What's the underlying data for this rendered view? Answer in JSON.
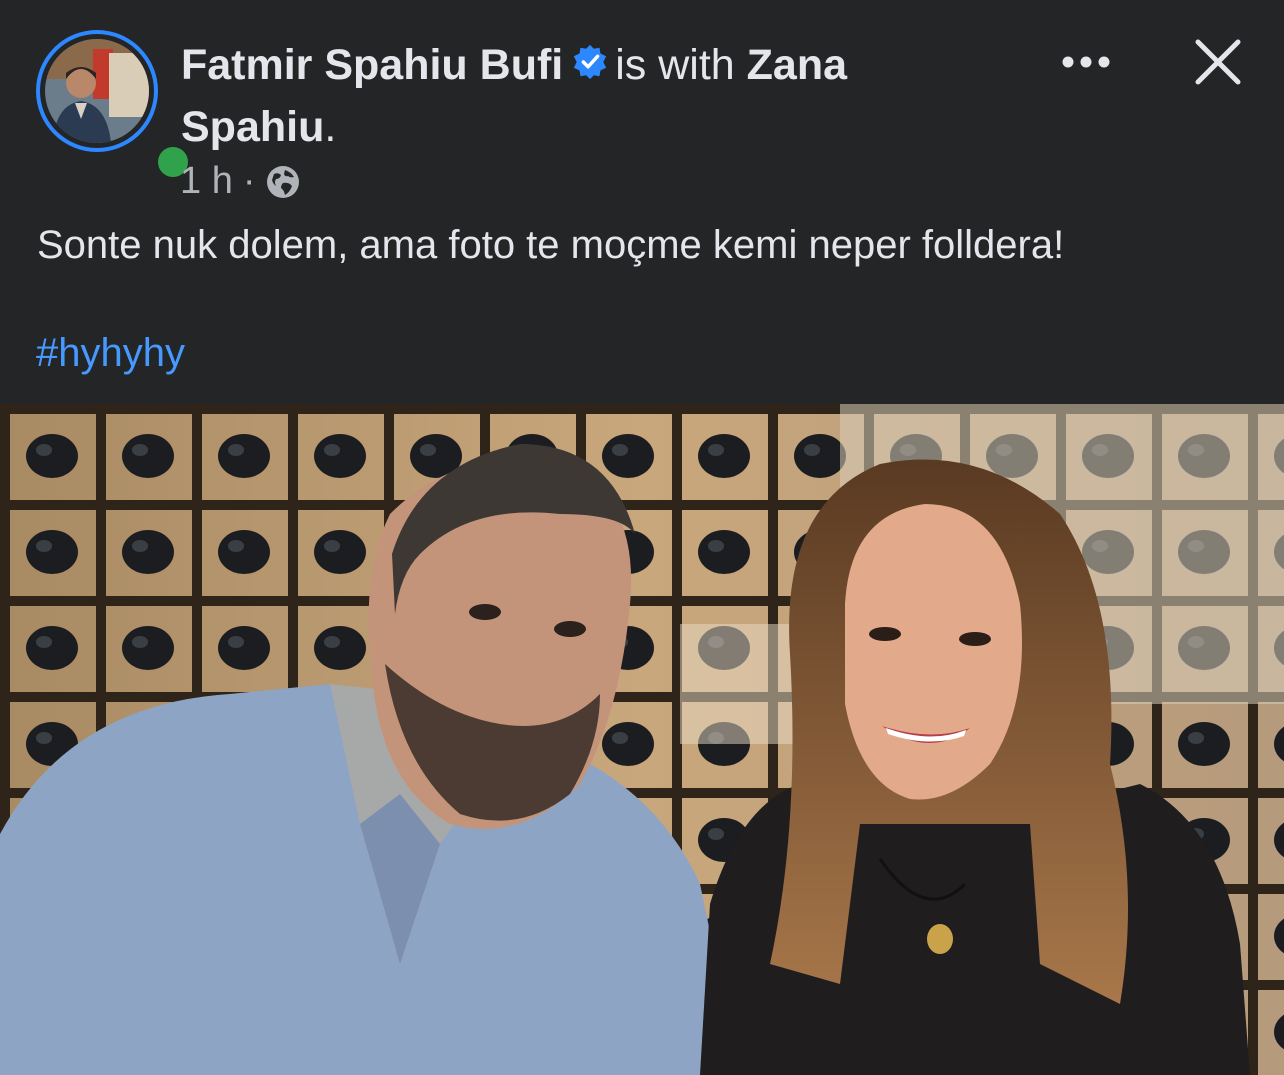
{
  "post": {
    "author_name": "Fatmir Spahiu Bufi",
    "with_text": "is with",
    "tagged_name": "Zana Spahiu",
    "period": ".",
    "timestamp": "1 h",
    "separator": "·",
    "audience_icon": "globe-icon",
    "verified_icon": "verified-badge-icon",
    "message": "Sonte nuk dolem, ama foto te moçme kemi neper folldera!",
    "hashtag": "#hyhyhy"
  },
  "actions": {
    "more_icon": "more-options-icon",
    "close_icon": "close-icon"
  },
  "colors": {
    "background": "#242526",
    "text_primary": "#e4e6eb",
    "text_secondary": "#b0b3b8",
    "link": "#4599ff",
    "verified": "#2d88ff",
    "online": "#31a24c"
  }
}
